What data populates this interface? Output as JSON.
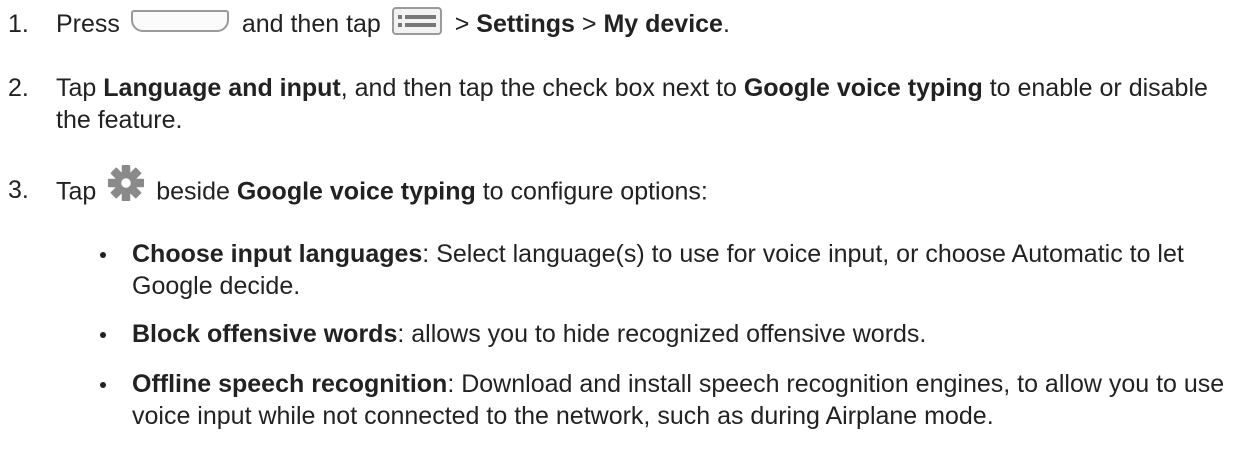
{
  "steps": [
    {
      "number": "1.",
      "press": "Press",
      "and_then_tap": "and then tap",
      "sep1": ">",
      "settings": "Settings",
      "sep2": ">",
      "my_device": "My device",
      "period": "."
    },
    {
      "number": "2.",
      "tap": "Tap",
      "language_and_input": "Language and input",
      "middle": ", and then tap the check box next to",
      "google_voice_typing": "Google voice typing",
      "end": "to enable or disable the feature."
    },
    {
      "number": "3.",
      "tap": "Tap",
      "beside": "beside",
      "google_voice_typing": "Google voice typing",
      "end": "to configure options:"
    }
  ],
  "options": [
    {
      "title": "Choose input languages",
      "desc": ": Select language(s) to use for voice input, or choose Automatic to let Google decide."
    },
    {
      "title": "Block offensive words",
      "desc": ": allows you to hide recognized offensive words."
    },
    {
      "title": "Offline speech recognition",
      "desc": ": Download and install speech recognition engines, to allow you to use voice input while not connected to the network, such as during Airplane mode."
    }
  ],
  "icons": {
    "home_button": "home-button-icon",
    "menu_button": "menu-button-icon",
    "gear": "gear-icon"
  },
  "colors": {
    "text": "#222222",
    "icon_gray": "#9a9a9a"
  }
}
